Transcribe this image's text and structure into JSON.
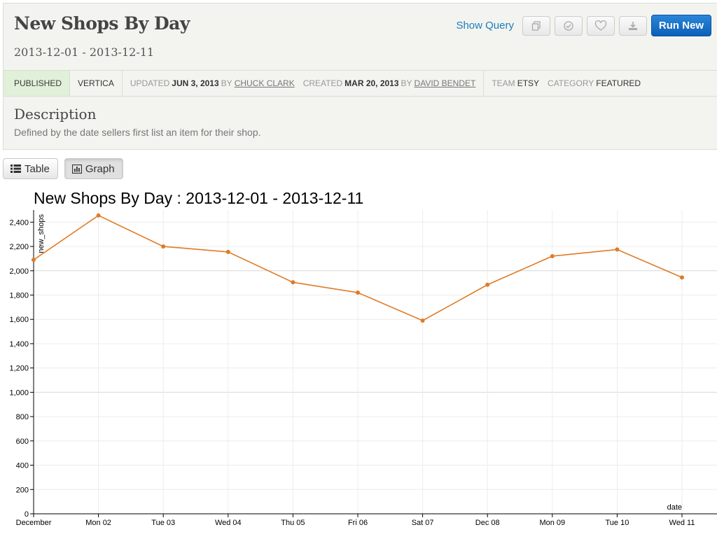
{
  "header": {
    "title": "New Shops By Day",
    "subtitle": "2013-12-01 - 2013-12-11",
    "show_query": "Show Query",
    "run_new": "Run New",
    "icons": [
      "copy-icon",
      "check-circle-icon",
      "heart-icon",
      "download-icon"
    ]
  },
  "meta": {
    "status": "PUBLISHED",
    "engine": "VERTICA",
    "updated_label": "UPDATED",
    "updated_date": "JUN 3, 2013",
    "by_label": "BY",
    "updated_by": "CHUCK CLARK",
    "created_label": "CREATED",
    "created_date": "MAR 20, 2013",
    "created_by": "DAVID BENDET",
    "team_label": "TEAM",
    "team": "ETSY",
    "category_label": "CATEGORY",
    "category": "FEATURED"
  },
  "description": {
    "title": "Description",
    "text": "Defined by the date sellers first list an item for their shop."
  },
  "tabs": {
    "table": "Table",
    "graph": "Graph",
    "active": "graph"
  },
  "chart_data": {
    "type": "line",
    "title": "New Shops By Day : 2013-12-01 - 2013-12-11",
    "xlabel": "date",
    "ylabel": "new_shops",
    "categories": [
      "December",
      "Mon 02",
      "Tue 03",
      "Wed 04",
      "Thu 05",
      "Fri 06",
      "Sat 07",
      "Dec 08",
      "Mon 09",
      "Tue 10",
      "Wed 11"
    ],
    "series": [
      {
        "values": [
          2090,
          2455,
          2200,
          2155,
          1905,
          1820,
          1590,
          1885,
          2120,
          2175,
          1945
        ],
        "color": "#e07b27"
      }
    ],
    "yticks": [
      0,
      200,
      400,
      600,
      800,
      1000,
      1200,
      1400,
      1600,
      1800,
      2000,
      2200,
      2400
    ],
    "ytick_labels": [
      "0",
      "200",
      "400",
      "600",
      "800",
      "1,000",
      "1,200",
      "1,400",
      "1,600",
      "1,800",
      "2,000",
      "2,200",
      "2,400"
    ],
    "ylim": [
      0,
      2500
    ],
    "grid": true
  }
}
